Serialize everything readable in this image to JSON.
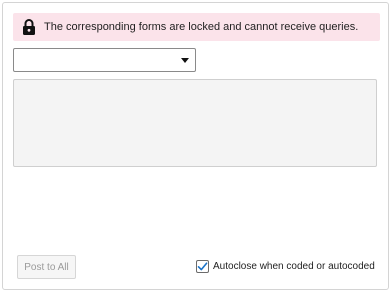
{
  "banner": {
    "icon": "lock-icon",
    "message": "The corresponding forms are locked and cannot receive queries.",
    "background_color": "#fbe3ea"
  },
  "recipient_select": {
    "selected_value": "",
    "icon": "caret-down-icon"
  },
  "query_text": {
    "value": ""
  },
  "footer": {
    "post_button_label": "Post to All",
    "autoclose": {
      "checked": true,
      "label": "Autoclose when coded or autocoded",
      "check_color": "#1a73c9"
    }
  }
}
